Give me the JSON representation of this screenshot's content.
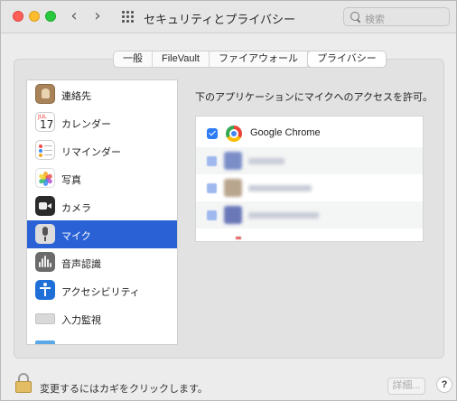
{
  "window": {
    "title": "セキュリティとプライバシー",
    "search_placeholder": "検索",
    "back_symbol": "‹",
    "forward_symbol": "›"
  },
  "tabs": [
    {
      "label": "一般",
      "active": false
    },
    {
      "label": "FileVault",
      "active": false
    },
    {
      "label": "ファイアウォール",
      "active": false
    },
    {
      "label": "プライバシー",
      "active": true
    }
  ],
  "sidebar": {
    "items": [
      {
        "label": "連絡先",
        "icon": "contacts-icon"
      },
      {
        "label": "カレンダー",
        "icon": "calendar-icon"
      },
      {
        "label": "リマインダー",
        "icon": "reminders-icon"
      },
      {
        "label": "写真",
        "icon": "photos-icon"
      },
      {
        "label": "カメラ",
        "icon": "camera-icon"
      },
      {
        "label": "マイク",
        "icon": "microphone-icon",
        "selected": true
      },
      {
        "label": "音声認識",
        "icon": "speech-recognition-icon"
      },
      {
        "label": "アクセシビリティ",
        "icon": "accessibility-icon"
      },
      {
        "label": "入力監視",
        "icon": "input-monitoring-icon"
      },
      {
        "label": "",
        "icon": "folder-icon"
      }
    ],
    "calendar_month": "JUL",
    "calendar_day": "17"
  },
  "main": {
    "heading": "下のアプリケーションにマイクへのアクセスを許可。",
    "apps": [
      {
        "name": "Google Chrome",
        "checked": true,
        "icon": "chrome-icon"
      }
    ]
  },
  "footer": {
    "lock_text": "変更するにはカギをクリックします。",
    "details_label": "詳細...",
    "help_label": "?"
  },
  "colors": {
    "selection": "#2a62d6",
    "checkbox": "#2e7bf6"
  }
}
